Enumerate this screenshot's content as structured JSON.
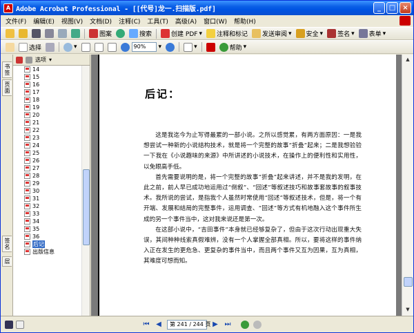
{
  "window": {
    "title": "Adobe Acrobat Professional - [[代号]龙一.扫描版.pdf]",
    "minimize": "_",
    "maximize": "□",
    "close": "×"
  },
  "menu": [
    "文件(F)",
    "编辑(E)",
    "视图(V)",
    "文档(D)",
    "注释(C)",
    "工具(T)",
    "高级(A)",
    "窗口(W)",
    "帮助(H)"
  ],
  "toolbar1": {
    "print_label": "图案",
    "search_label": "搜索",
    "create_pdf": "创建 PDF",
    "comment": "注释和标记",
    "send_review": "发送审阅",
    "secure": "安全",
    "sign": "签名",
    "forms": "表单"
  },
  "toolbar2": {
    "select": "选择",
    "zoom": "90%",
    "help": "帮助"
  },
  "navtabs": [
    "书签",
    "页面",
    "签名",
    "层"
  ],
  "panel": {
    "options": "选项"
  },
  "bookmarks": [
    {
      "label": "14"
    },
    {
      "label": "15"
    },
    {
      "label": "16"
    },
    {
      "label": "17"
    },
    {
      "label": "18"
    },
    {
      "label": "19"
    },
    {
      "label": "20"
    },
    {
      "label": "21"
    },
    {
      "label": "22"
    },
    {
      "label": "23"
    },
    {
      "label": "24"
    },
    {
      "label": "25"
    },
    {
      "label": "26"
    },
    {
      "label": "27"
    },
    {
      "label": "28"
    },
    {
      "label": "29"
    },
    {
      "label": "30"
    },
    {
      "label": "31"
    },
    {
      "label": "32"
    },
    {
      "label": "33"
    },
    {
      "label": "34"
    },
    {
      "label": "35"
    },
    {
      "label": "36"
    },
    {
      "label": "后记"
    },
    {
      "label": "出版信息"
    }
  ],
  "selected_bookmark": "后记",
  "document": {
    "heading": "后记：",
    "paragraphs": [
      "这是我迄今为止写得最累的一部小说。之所以感觉累，有两方面原因：一是我想尝试一种新的小说结构技术，就是将一个完整的故事“折叠”起来；二是我想验验一下我在《小说趣味的来源》中所讲述的小说技术，在操作上的便利性和实用性，以免眼高手低。",
      "首先需要说明的是，将一个完整的故事“折叠”起来讲述，并不是我的发明，在此之前，前人早已成功地运用过“倒叙”、“回述”等叙述技巧和故事套故事的叙事技术。我所说的尝试，是指我个人虽然时常使用“回述”等叙述技术，但是，将一个有开端、发展和结局的完整事件，运用调查、“回述”等方式有机地融入这个事件所生成的另一个事件当中，这对我来说还是第一次。",
      "在这部小说中，“吉田事件”本身就已经够复杂了，但由于这次行动出现重大失误，其间种种线索真假难辨，没有一个人掌握全部真相。所以，要将这样的事件纳入正在发生的更危急、更复杂的事件当中，而且两个事件又互为因果，互为真相，其难度可想而知。"
    ]
  },
  "statusbar": {
    "page": "第 241 / 244 页"
  }
}
